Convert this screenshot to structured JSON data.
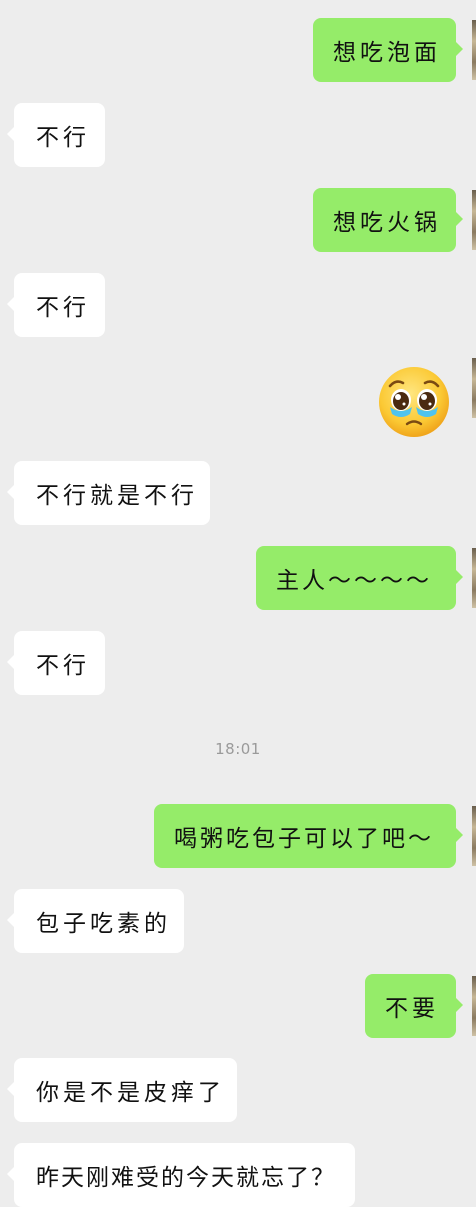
{
  "chat": {
    "messages": [
      {
        "side": "out",
        "text": "想吃泡面"
      },
      {
        "side": "in",
        "text": "不行"
      },
      {
        "side": "out",
        "text": "想吃火锅"
      },
      {
        "side": "in",
        "text": "不行"
      },
      {
        "side": "out",
        "sticker": "pleading-face-emoji"
      },
      {
        "side": "in",
        "text": "不行就是不行"
      },
      {
        "side": "out",
        "text": "主人～～～～"
      },
      {
        "side": "in",
        "text": "不行"
      },
      {
        "timestamp": "18:01"
      },
      {
        "side": "out",
        "text": "喝粥吃包子可以了吧～"
      },
      {
        "side": "in",
        "text": "包子吃素的"
      },
      {
        "side": "out",
        "text": "不要"
      },
      {
        "side": "in",
        "text": "你是不是皮痒了"
      },
      {
        "side": "in",
        "text": "昨天刚难受的今天就忘了？"
      }
    ]
  },
  "colors": {
    "background": "#ededed",
    "incoming_bubble": "#ffffff",
    "outgoing_bubble": "#95ec69"
  }
}
